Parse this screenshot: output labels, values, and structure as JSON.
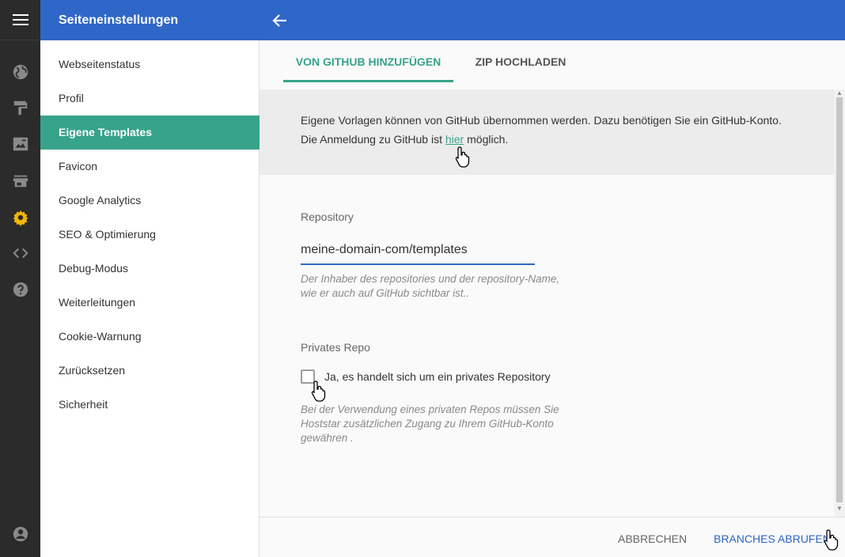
{
  "header": {
    "title": "Seiteneinstellungen",
    "back_icon": "arrow-left-icon"
  },
  "rail": {
    "icons": [
      "menu-icon",
      "globe-icon",
      "paint-roller-icon",
      "image-edit-icon",
      "store-icon",
      "gear-icon",
      "code-icon",
      "help-icon",
      "account-icon"
    ],
    "active_color": "#f2b800"
  },
  "menu": {
    "items": [
      {
        "label": "Webseitenstatus"
      },
      {
        "label": "Profil"
      },
      {
        "label": "Eigene Templates"
      },
      {
        "label": "Favicon"
      },
      {
        "label": "Google Analytics"
      },
      {
        "label": "SEO & Optimierung"
      },
      {
        "label": "Debug-Modus"
      },
      {
        "label": "Weiterleitungen"
      },
      {
        "label": "Cookie-Warnung"
      },
      {
        "label": "Zurücksetzen"
      },
      {
        "label": "Sicherheit"
      }
    ],
    "active_index": 2
  },
  "tabs": [
    {
      "label": "VON GITHUB HINZUFÜGEN",
      "active": true
    },
    {
      "label": "ZIP HOCHLADEN",
      "active": false
    }
  ],
  "info": {
    "line1": "Eigene Vorlagen können von GitHub übernommen werden. Dazu benötigen Sie ein GitHub-Konto.",
    "line2_before": "Die Anmeldung zu GitHub ist ",
    "line2_link": "hier",
    "line2_after": " möglich."
  },
  "repository": {
    "label": "Repository",
    "value": "meine-domain-com/templates",
    "hint_line1": "Der Inhaber des repositories und der repository-Name,",
    "hint_line2": "wie er auch auf GitHub sichtbar ist.."
  },
  "private_repo": {
    "label": "Privates Repo",
    "checkbox_label": "Ja, es handelt sich um ein privates Repository",
    "checked": false,
    "hint_line1": "Bei der Verwendung eines privaten Repos müssen Sie",
    "hint_line2": "Hoststar zusätzlichen Zugang zu Ihrem GitHub-Konto",
    "hint_line3": "gewähren ."
  },
  "footer": {
    "cancel_label": "ABBRECHEN",
    "primary_label": "BRANCHES ABRUFEN"
  },
  "colors": {
    "header": "#2f67c8",
    "accent": "#37a38b",
    "rail": "#2b2b2b"
  }
}
